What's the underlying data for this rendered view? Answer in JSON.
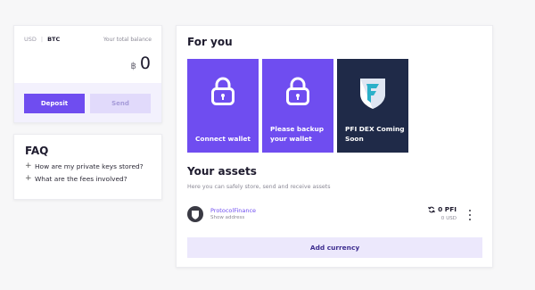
{
  "balance": {
    "currency_usd": "USD",
    "currency_btc": "BTC",
    "label": "Your total balance",
    "symbol": "฿",
    "amount": "0",
    "deposit_label": "Deposit",
    "send_label": "Send"
  },
  "faq": {
    "title": "FAQ",
    "items": [
      {
        "label": "How are my private keys stored?"
      },
      {
        "label": "What are the fees involved?"
      }
    ]
  },
  "for_you": {
    "title": "For you",
    "tiles": [
      {
        "label_line1": "Connect wallet",
        "label_line2": "",
        "icon": "lock-icon",
        "color": "#6f4df0"
      },
      {
        "label_line1": "Please backup",
        "label_line2": "your wallet",
        "icon": "lock-icon",
        "color": "#6f4df0"
      },
      {
        "label_line1": "PFI DEX Coming",
        "label_line2": "Soon",
        "icon": "pfi-shield-icon",
        "color": "#1f2a48"
      }
    ]
  },
  "assets": {
    "title": "Your assets",
    "subtitle": "Here you can safely store, send and receive assets",
    "rows": [
      {
        "name": "ProtocolFinance",
        "address_link": "Show address",
        "balance": "0 PFI",
        "usd_value": "0",
        "usd_unit": "USD"
      }
    ],
    "add_label": "Add currency"
  },
  "colors": {
    "accent": "#6f4df0",
    "navy": "#1f2a48",
    "accent_soft": "#ece8fc"
  }
}
